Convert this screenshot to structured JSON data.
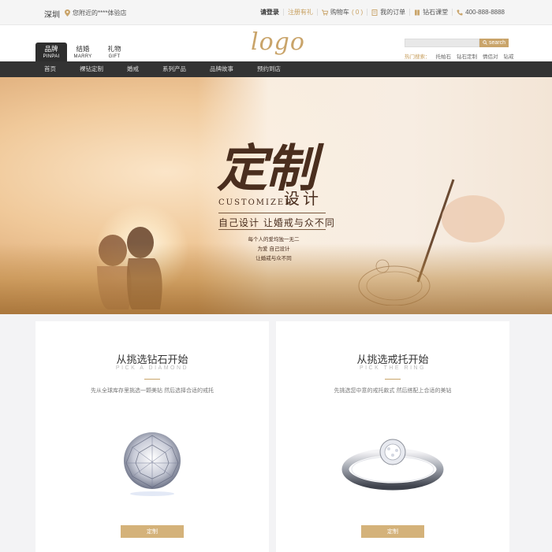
{
  "topbar": {
    "city": "深圳",
    "location_text": "您附近的****体验店",
    "login": "请登录",
    "register": "注册有礼",
    "cart_label": "购物车",
    "cart_count": "( 0 )",
    "orders": "我的订单",
    "diamond_class": "钻石课堂",
    "phone": "400-888-8888",
    "icons": [
      "location-pin-icon",
      "cart-icon",
      "order-icon",
      "book-icon",
      "phone-icon"
    ]
  },
  "header": {
    "tabs": [
      {
        "cn": "品牌",
        "en": "PINPAI"
      },
      {
        "cn": "结婚",
        "en": "MARRY"
      },
      {
        "cn": "礼物",
        "en": "GIFT"
      }
    ],
    "logo": "logo",
    "search_placeholder": "",
    "search_button": "search",
    "hot_label": "热门搜索：",
    "hot_items": [
      "托帕石",
      "钻石定制",
      "情侣对",
      "钻戒"
    ]
  },
  "nav": {
    "items": [
      "首页",
      "裸钻定制",
      "婚戒",
      "系列产品",
      "品牌故事",
      "预约到店"
    ]
  },
  "banner": {
    "title": "定制",
    "title_en": "CUSTOMIZED",
    "title_sub": "设计",
    "slogan": "自己设计 让婚戒与众不同",
    "lines": [
      "每个人的爱均独一无二",
      "为爱 自己设计",
      "让婚戒与众不同"
    ]
  },
  "cards": [
    {
      "title": "从挑选钻石开始",
      "subtitle": "PICK A DIAMOND",
      "desc": "先从全球库存里挑选一颗美钻 然后选择合适的戒托",
      "button": "定制",
      "image": "diamond-image"
    },
    {
      "title": "从挑选戒托开始",
      "subtitle": "PICK THE RING",
      "desc": "先挑选您中意的戒托款式 然后搭配上合适的美钻",
      "button": "定制",
      "image": "ring-image"
    }
  ],
  "colors": {
    "accent": "#c9a46a",
    "nav_bg": "#333333",
    "banner_text": "#4a2e1e"
  }
}
